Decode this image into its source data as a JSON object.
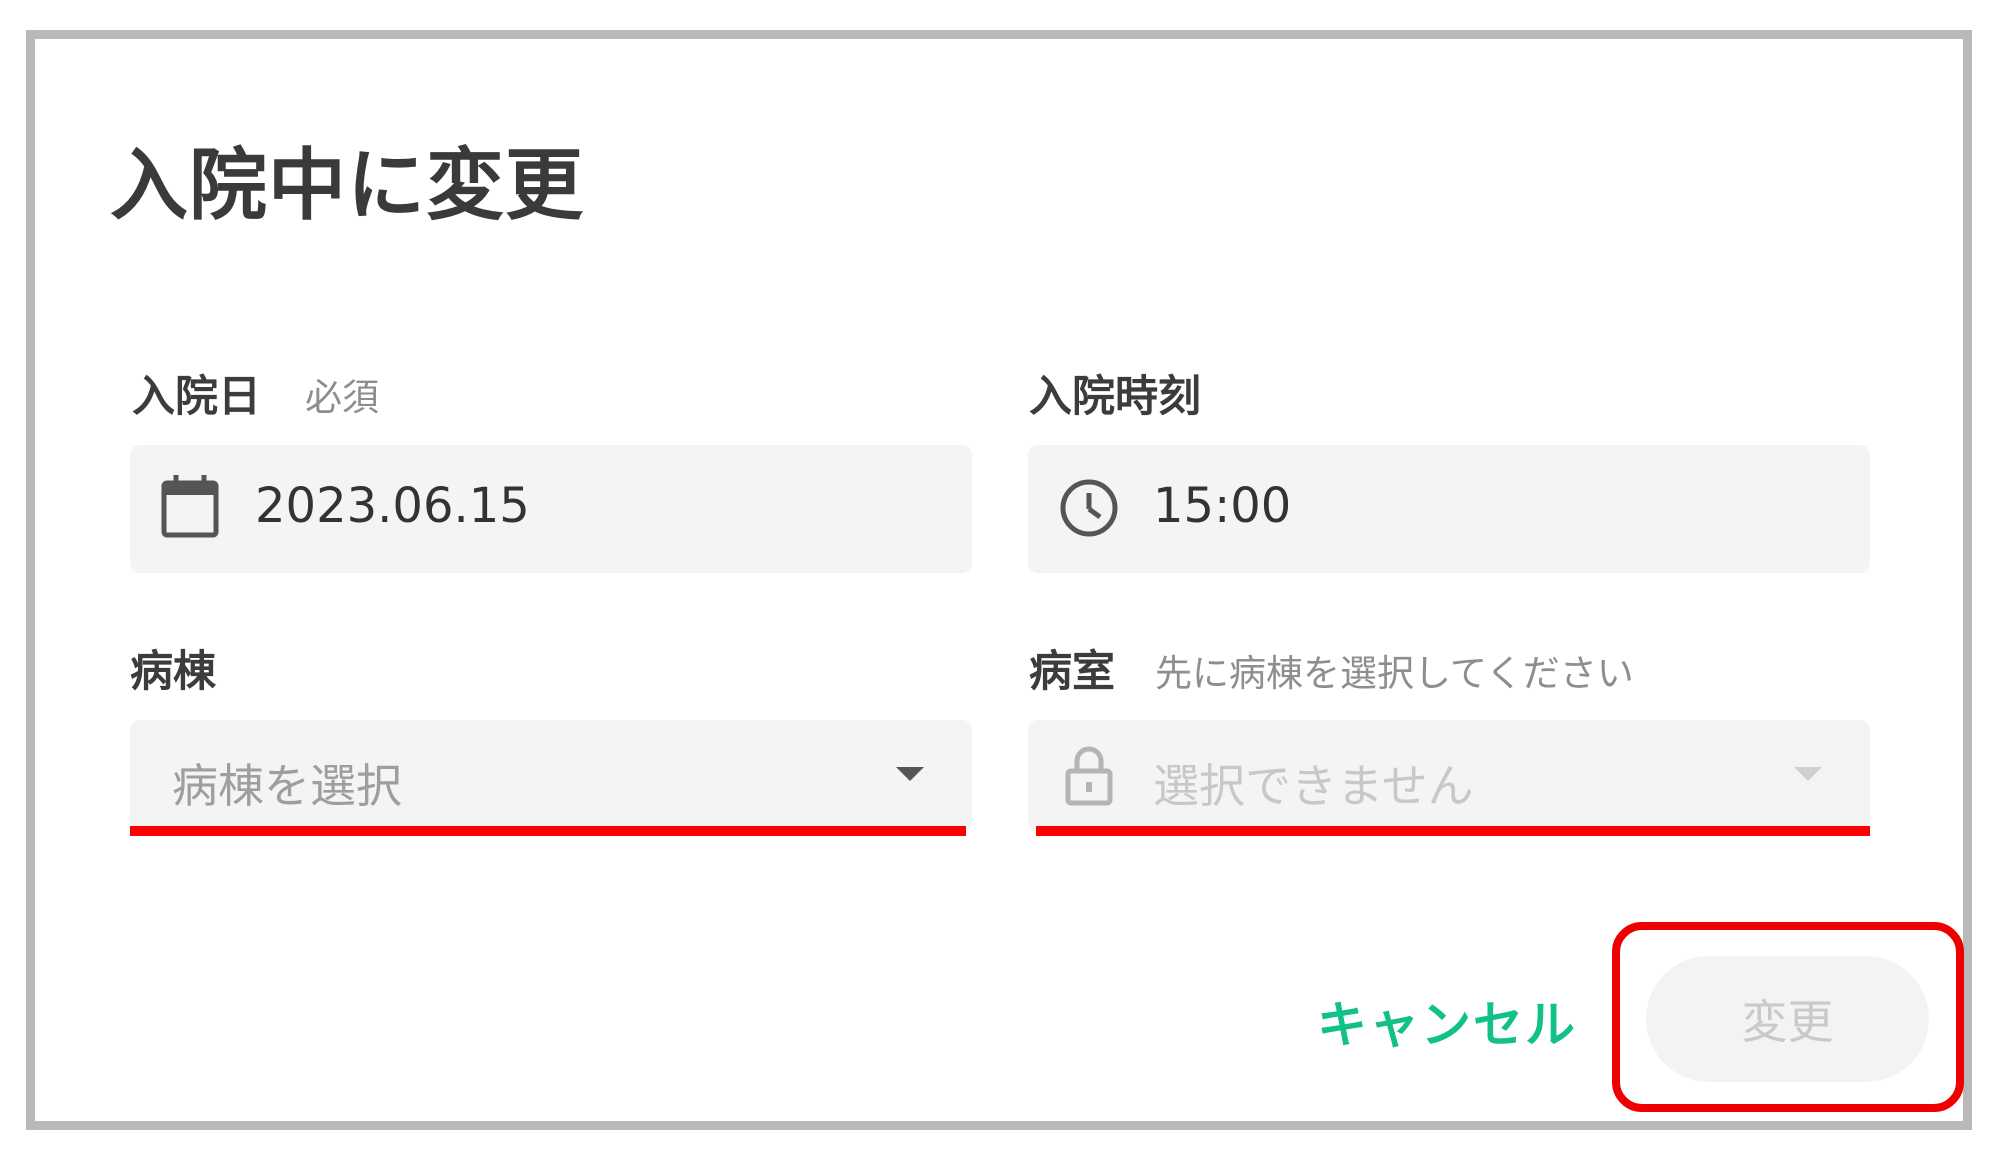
{
  "dialog": {
    "title": "入院中に変更"
  },
  "admission_date": {
    "label": "入院日",
    "required_text": "必須",
    "value": "2023.06.15",
    "icon": "calendar-icon"
  },
  "admission_time": {
    "label": "入院時刻",
    "value": "15:00",
    "icon": "clock-icon"
  },
  "ward": {
    "label": "病棟",
    "placeholder": "病棟を選択",
    "icon": "caret-down-icon"
  },
  "room": {
    "label": "病室",
    "hint": "先に病棟を選択してください",
    "placeholder": "選択できません",
    "icon": "lock-icon",
    "disabled": true
  },
  "actions": {
    "cancel_label": "キャンセル",
    "submit_label": "変更"
  },
  "colors": {
    "accent": "#12c08a",
    "annotation": "#ff0000",
    "field_bg": "#f4f4f4"
  }
}
